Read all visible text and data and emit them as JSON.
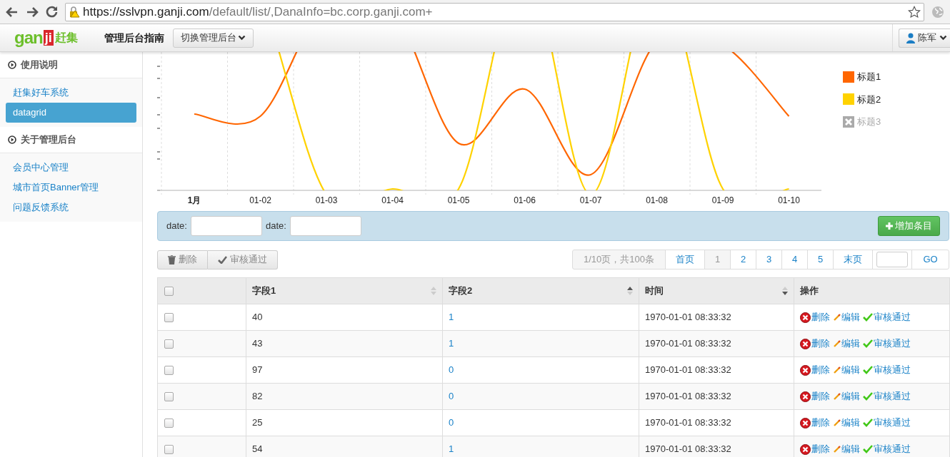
{
  "browser": {
    "url_host": "https://sslvpn.ganji.com",
    "url_path": "/default/list/,DanaInfo=bc.corp.ganji.com+"
  },
  "header": {
    "logo_latin": "gan",
    "logo_badge": "ji",
    "logo_cn": "赶集",
    "title": "管理后台指南",
    "switch_button": "切换管理后台",
    "user": "陈军"
  },
  "sidebar": [
    {
      "title": "使用说明",
      "items": [
        {
          "label": "赶集好车系统",
          "selected": false
        },
        {
          "label": "datagrid",
          "selected": true
        }
      ]
    },
    {
      "title": "关于管理后台",
      "items": [
        {
          "label": "会员中心管理",
          "selected": false
        },
        {
          "label": "城市首页Banner管理",
          "selected": false
        },
        {
          "label": "问题反馈系统",
          "selected": false
        }
      ]
    }
  ],
  "chart": {
    "x_labels": [
      "1月",
      "01-02",
      "01-03",
      "01-04",
      "01-05",
      "01-06",
      "01-07",
      "01-08",
      "01-09",
      "01-10"
    ],
    "legend": [
      {
        "label": "标题1",
        "color": "#ff6600",
        "visible": true
      },
      {
        "label": "标题2",
        "color": "#ffd200",
        "visible": true
      },
      {
        "label": "标题3",
        "color": "#aaaaaa",
        "visible": false
      }
    ]
  },
  "filter": {
    "fields": [
      {
        "label": "date:"
      },
      {
        "label": "date:"
      }
    ],
    "add_button": "增加条目"
  },
  "toolbar": [
    {
      "kind": "trash",
      "label": "删除"
    },
    {
      "kind": "check",
      "label": "审核通过"
    }
  ],
  "pagination": {
    "summary": "1/10页，共100条",
    "first": "首页",
    "pages": [
      {
        "label": "1",
        "selected": true
      },
      {
        "label": "2",
        "selected": false
      },
      {
        "label": "3",
        "selected": false
      },
      {
        "label": "4",
        "selected": false
      },
      {
        "label": "5",
        "selected": false
      }
    ],
    "last": "末页",
    "go": "GO"
  },
  "table": {
    "header_checked": false,
    "columns": [
      {
        "label": "字段1",
        "sortable": true,
        "sorted_up": false,
        "sorted_down": false
      },
      {
        "label": "字段2",
        "sortable": true,
        "sorted_up": true,
        "sorted_down": false
      },
      {
        "label": "时间",
        "sortable": true,
        "sorted_up": false,
        "sorted_down": true
      },
      {
        "label": "操作",
        "sortable": false
      }
    ],
    "rows": [
      {
        "checked": false,
        "field1": "40",
        "field2": "1",
        "time": "1970-01-01 08:33:32",
        "actions": [
          {
            "kind": "delete",
            "label": "删除"
          },
          {
            "kind": "edit",
            "label": "编辑"
          },
          {
            "kind": "approve",
            "label": "审核通过"
          }
        ]
      },
      {
        "checked": false,
        "field1": "43",
        "field2": "1",
        "time": "1970-01-01 08:33:32",
        "actions": [
          {
            "kind": "delete",
            "label": "删除"
          },
          {
            "kind": "edit",
            "label": "编辑"
          },
          {
            "kind": "approve",
            "label": "审核通过"
          }
        ]
      },
      {
        "checked": false,
        "field1": "97",
        "field2": "0",
        "time": "1970-01-01 08:33:32",
        "actions": [
          {
            "kind": "delete",
            "label": "删除"
          },
          {
            "kind": "edit",
            "label": "编辑"
          },
          {
            "kind": "approve",
            "label": "审核通过"
          }
        ]
      },
      {
        "checked": false,
        "field1": "82",
        "field2": "0",
        "time": "1970-01-01 08:33:32",
        "actions": [
          {
            "kind": "delete",
            "label": "删除"
          },
          {
            "kind": "edit",
            "label": "编辑"
          },
          {
            "kind": "approve",
            "label": "审核通过"
          }
        ]
      },
      {
        "checked": false,
        "field1": "25",
        "field2": "0",
        "time": "1970-01-01 08:33:32",
        "actions": [
          {
            "kind": "delete",
            "label": "删除"
          },
          {
            "kind": "edit",
            "label": "编辑"
          },
          {
            "kind": "approve",
            "label": "审核通过"
          }
        ]
      },
      {
        "checked": false,
        "field1": "54",
        "field2": "1",
        "time": "1970-01-01 08:33:32",
        "actions": [
          {
            "kind": "delete",
            "label": "删除"
          },
          {
            "kind": "edit",
            "label": "编辑"
          },
          {
            "kind": "approve",
            "label": "审核通过"
          }
        ]
      }
    ]
  }
}
